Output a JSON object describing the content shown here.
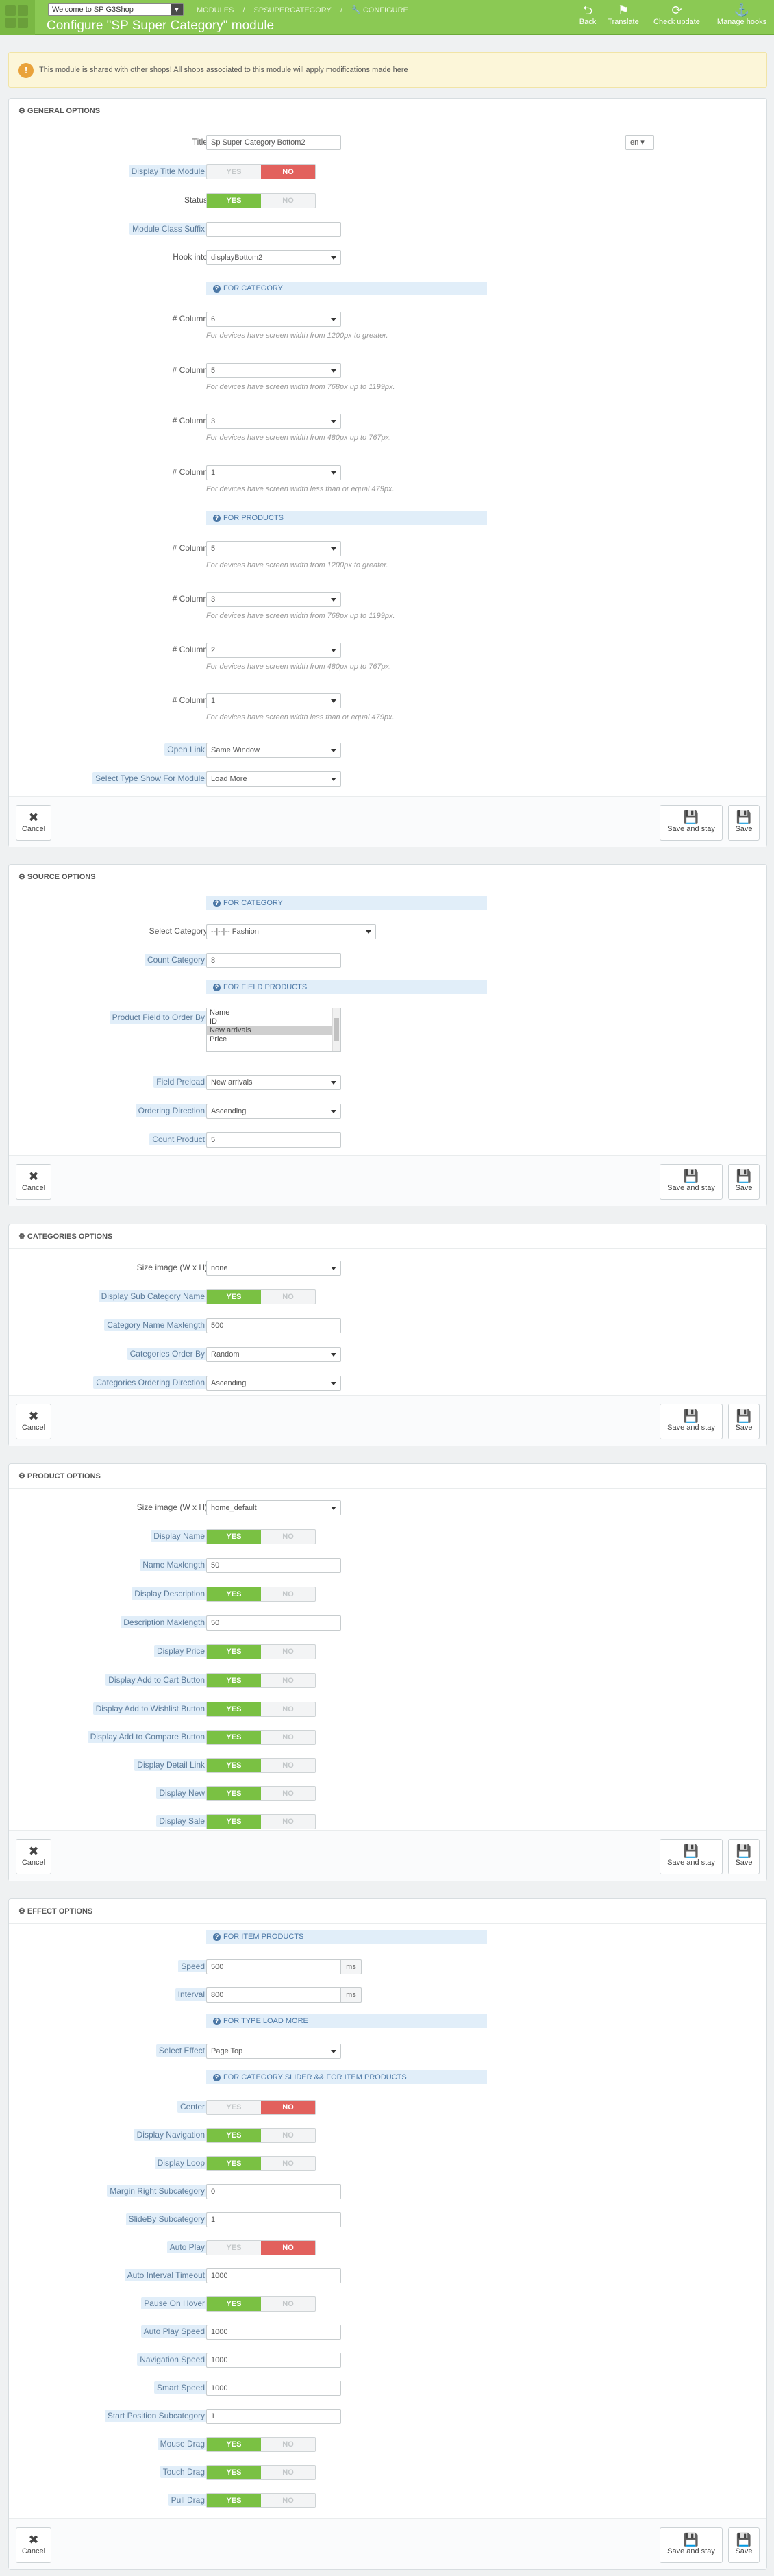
{
  "header": {
    "shop": "Welcome to SP G3Shop",
    "breadcrumbs": [
      "MODULES",
      "SPSUPERCATEGORY",
      "CONFIGURE"
    ],
    "title": "Configure \"SP Super Category\" module",
    "toolbar": [
      {
        "name": "back",
        "label": "Back",
        "icon": "back-arrow"
      },
      {
        "name": "translate",
        "label": "Translate",
        "icon": "flag"
      },
      {
        "name": "check-update",
        "label": "Check update",
        "icon": "refresh"
      },
      {
        "name": "manage-hooks",
        "label": "Manage hooks",
        "icon": "anchor"
      }
    ]
  },
  "notice": "This module is shared with other shops! All shops associated to this module will apply modifications made here",
  "footer": {
    "cancel": "Cancel",
    "save_stay": "Save and stay",
    "save": "Save"
  },
  "switch": {
    "yes": "YES",
    "no": "NO"
  },
  "general": {
    "title": "GENERAL OPTIONS",
    "lang": "en",
    "fields": {
      "title_label": "Title",
      "title_value": "Sp Super Category Bottom2",
      "display_title": "Display Title Module",
      "status": "Status",
      "class_suffix": "Module Class Suffix",
      "hook_into": "Hook into",
      "hook_value": "displayBottom2",
      "open_link": "Open Link",
      "open_link_value": "Same Window",
      "type_show": "Select Type Show For Module",
      "type_show_value": "Load More"
    },
    "for_category": "FOR CATEGORY",
    "for_products": "FOR PRODUCTS",
    "columns_label": "# Column",
    "cat_columns": [
      "6",
      "5",
      "3",
      "1"
    ],
    "prod_columns": [
      "5",
      "3",
      "2",
      "1"
    ],
    "hints": [
      "For devices have screen width from 1200px to greater.",
      "For devices have screen width from 768px up to 1199px.",
      "For devices have screen width from 480px up to 767px.",
      "For devices have screen width less than or equal 479px."
    ]
  },
  "source": {
    "title": "SOURCE OPTIONS",
    "for_category": "FOR CATEGORY",
    "select_category": "Select Category",
    "select_category_value": "--|--|-- Fashion",
    "count_category": "Count Category",
    "count_category_value": "8",
    "for_field": "FOR FIELD PRODUCTS",
    "product_field": "Product Field to Order By",
    "product_field_options": [
      "Name",
      "ID",
      "New arrivals",
      "Price"
    ],
    "field_preload": "Field Preload",
    "field_preload_value": "New arrivals",
    "ordering_direction": "Ordering Direction",
    "ordering_direction_value": "Ascending",
    "count_product": "Count Product",
    "count_product_value": "5"
  },
  "categories": {
    "title": "CATEGORIES OPTIONS",
    "size_image": "Size image (W x H)",
    "size_image_value": "none",
    "display_sub": "Display Sub Category Name",
    "name_max": "Category Name Maxlength",
    "name_max_value": "500",
    "order_by": "Categories Order By",
    "order_by_value": "Random",
    "order_dir": "Categories Ordering Direction",
    "order_dir_value": "Ascending"
  },
  "product": {
    "title": "PRODUCT OPTIONS",
    "size_image": "Size image (W x H)",
    "size_image_value": "home_default",
    "display_name": "Display Name",
    "name_max": "Name Maxlength",
    "name_max_value": "50",
    "display_desc": "Display Description",
    "desc_max": "Description Maxlength",
    "desc_max_value": "50",
    "display_price": "Display Price",
    "add_cart": "Display Add to Cart Button",
    "add_wishlist": "Display Add to Wishlist Button",
    "add_compare": "Display Add to Compare Button",
    "detail_link": "Display Detail Link",
    "display_new": "Display New",
    "display_sale": "Display Sale"
  },
  "effect": {
    "title": "EFFECT OPTIONS",
    "for_item": "FOR ITEM PRODUCTS",
    "speed": "Speed",
    "speed_value": "500",
    "interval": "Interval",
    "interval_value": "800",
    "ms": "ms",
    "for_load_more": "FOR TYPE LOAD MORE",
    "select_effect": "Select Effect",
    "select_effect_value": "Page Top",
    "for_slider": "FOR CATEGORY SLIDER && FOR ITEM PRODUCTS",
    "center": "Center",
    "display_nav": "Display Navigation",
    "display_loop": "Display Loop",
    "margin_right": "Margin Right Subcategory",
    "margin_right_value": "0",
    "slideby": "SlideBy Subcategory",
    "slideby_value": "1",
    "auto_play": "Auto Play",
    "auto_interval": "Auto Interval Timeout",
    "auto_interval_value": "1000",
    "pause_hover": "Pause On Hover",
    "auto_play_speed": "Auto Play Speed",
    "auto_play_speed_value": "1000",
    "nav_speed": "Navigation Speed",
    "nav_speed_value": "1000",
    "smart_speed": "Smart Speed",
    "smart_speed_value": "1000",
    "start_pos": "Start Position Subcategory",
    "start_pos_value": "1",
    "mouse_drag": "Mouse Drag",
    "touch_drag": "Touch Drag",
    "pull_drag": "Pull Drag"
  }
}
